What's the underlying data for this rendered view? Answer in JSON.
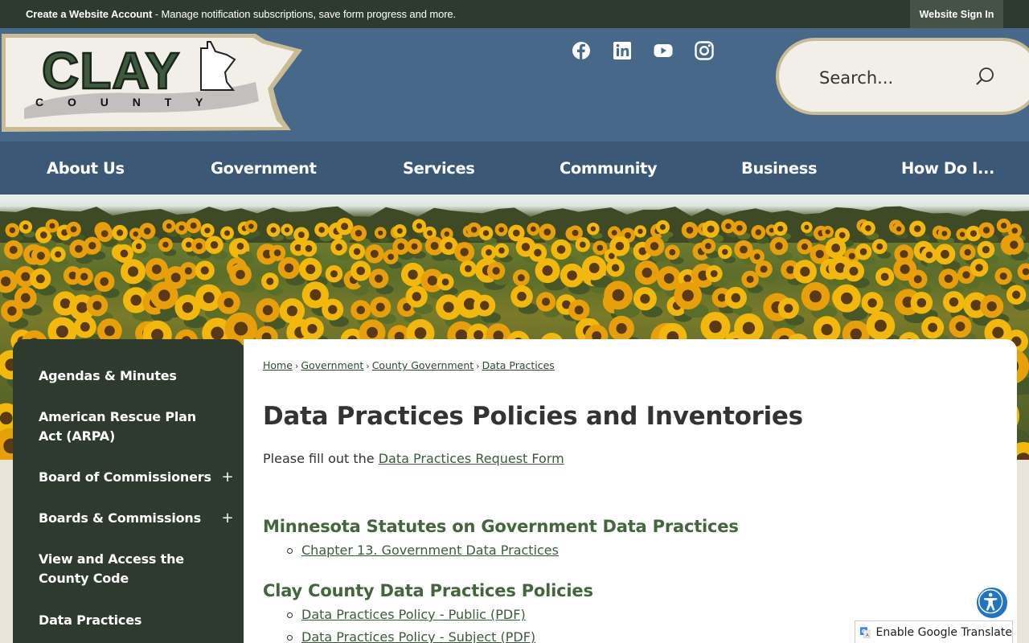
{
  "topbar": {
    "notice_bold": "Create a Website Account",
    "notice_rest": " - Manage notification subscriptions, save form progress and more.",
    "signin_label": "Website Sign In"
  },
  "header": {
    "logo_word": "CLAY",
    "logo_sub": "C O U N T Y",
    "social": [
      "facebook-icon",
      "linkedin-icon",
      "youtube-icon",
      "instagram-icon"
    ],
    "search_placeholder": "Search..."
  },
  "nav": {
    "items": [
      "About Us",
      "Government",
      "Services",
      "Community",
      "Business",
      "How Do I..."
    ]
  },
  "sidebar": {
    "items": [
      {
        "label": "Agendas & Minutes",
        "expandable": false
      },
      {
        "label": "American Rescue Plan Act (ARPA)",
        "expandable": false
      },
      {
        "label": "Board of Commissioners",
        "expandable": true
      },
      {
        "label": "Boards & Commissions",
        "expandable": true
      },
      {
        "label": "View and Access the County Code",
        "expandable": false
      },
      {
        "label": "Data Practices",
        "expandable": false
      }
    ],
    "expander_symbol": "+"
  },
  "breadcrumb": [
    "Home",
    "Government",
    "County Government",
    "Data Practices"
  ],
  "breadcrumb_sep": "›",
  "main": {
    "title": "Data Practices Policies and Inventories",
    "intro_text": "Please fill out the ",
    "intro_link": "Data Practices Request Form",
    "sections": [
      {
        "heading": "Minnesota Statutes on Government Data Practices",
        "links": [
          "Chapter 13. Government Data Practices"
        ]
      },
      {
        "heading": "Clay County Data Practices Policies",
        "links": [
          "Data Practices Policy - Public (PDF)",
          "Data Practices Policy - Subject (PDF)"
        ]
      }
    ]
  },
  "translate_label": "Enable Google Translate",
  "colors": {
    "topbar": "#2f3a2f",
    "header": "#48688a",
    "nav": "#3b5977",
    "accent_green": "#45643f"
  }
}
